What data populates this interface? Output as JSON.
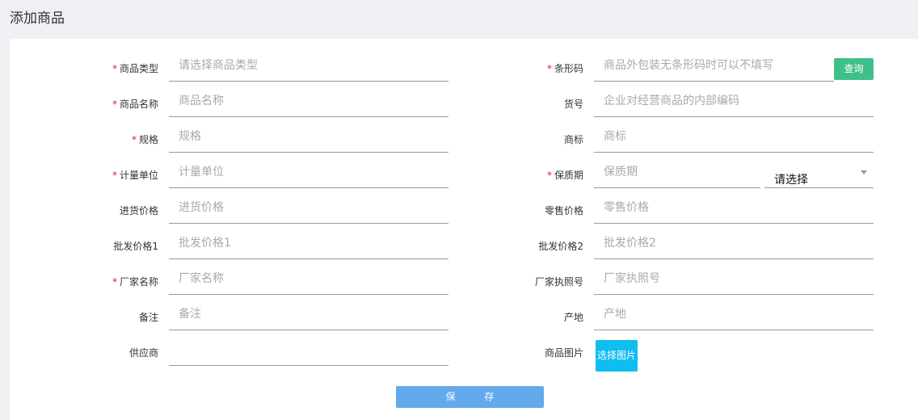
{
  "page": {
    "title": "添加商品"
  },
  "form": {
    "left": [
      {
        "label": "商品类型",
        "required": true,
        "placeholder": "请选择商品类型"
      },
      {
        "label": "商品名称",
        "required": true,
        "placeholder": "商品名称"
      },
      {
        "label": "规格",
        "required": true,
        "placeholder": "规格"
      },
      {
        "label": "计量单位",
        "required": true,
        "placeholder": "计量单位"
      },
      {
        "label": "进货价格",
        "required": false,
        "placeholder": "进货价格"
      },
      {
        "label": "批发价格1",
        "required": false,
        "placeholder": "批发价格1"
      },
      {
        "label": "厂家名称",
        "required": true,
        "placeholder": "厂家名称"
      },
      {
        "label": "备注",
        "required": false,
        "placeholder": "备注"
      },
      {
        "label": "供应商",
        "required": false,
        "placeholder": ""
      }
    ],
    "right": [
      {
        "label": "条形码",
        "required": true,
        "placeholder": "商品外包装无条形码时可以不填写"
      },
      {
        "label": "货号",
        "required": false,
        "placeholder": "企业对经营商品的内部编码"
      },
      {
        "label": "商标",
        "required": false,
        "placeholder": "商标"
      },
      {
        "label": "保质期",
        "required": true,
        "placeholder": "保质期"
      },
      {
        "label": "零售价格",
        "required": false,
        "placeholder": "零售价格"
      },
      {
        "label": "批发价格2",
        "required": false,
        "placeholder": "批发价格2"
      },
      {
        "label": "厂家执照号",
        "required": false,
        "placeholder": "厂家执照号"
      },
      {
        "label": "产地",
        "required": false,
        "placeholder": "产地"
      },
      {
        "label": "商品图片",
        "required": false,
        "placeholder": ""
      }
    ],
    "required_mark": "*",
    "query_button": "查询",
    "shelf_life_unit": {
      "value": "请选择"
    },
    "image_button": "选择图片",
    "save_button": "保 存"
  },
  "colors": {
    "query_button": "#3fc08b",
    "image_button": "#10bdf0",
    "save_button": "#62aaeb",
    "required_mark": "#e02020"
  }
}
